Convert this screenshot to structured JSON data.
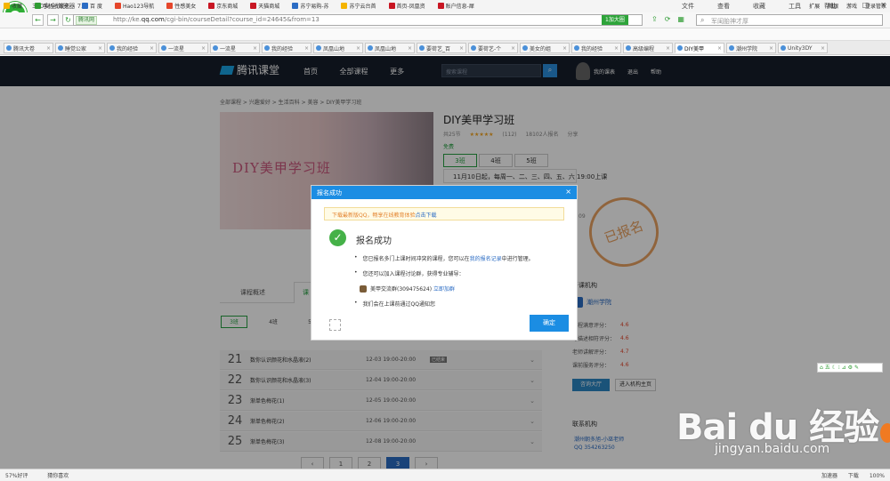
{
  "browser": {
    "app_title": "360安全浏览器 7.1",
    "menu": [
      "文件",
      "查看",
      "收藏",
      "工具",
      "帮助"
    ],
    "url_site": "腾讯网",
    "url_prefix": "http://ke.",
    "url_domain": "qq.com",
    "url_path": "/cgi-bin/courseDetail?course_id=24645&from=13",
    "zoom_label": "1加大圈",
    "search_placeholder": "军闺胎神才厚",
    "favorites": [
      {
        "label": "收藏",
        "color": "#f5b400"
      },
      {
        "label": "手机收藏夹",
        "color": "#2e9b32"
      },
      {
        "label": "百 度",
        "color": "#2b6cc4"
      },
      {
        "label": "Hao123导航",
        "color": "#e5462b"
      },
      {
        "label": "性感美女",
        "color": "#e5462b"
      },
      {
        "label": "京东商城",
        "color": "#c81623"
      },
      {
        "label": "天猫商城",
        "color": "#c81623"
      },
      {
        "label": "苏宁易购-苏",
        "color": "#2b6cc4"
      },
      {
        "label": "苏宁云台首",
        "color": "#f5b400"
      },
      {
        "label": "首页-凤凰资",
        "color": "#c81623"
      },
      {
        "label": "账户信息-犀",
        "color": "#c81623"
      }
    ],
    "fav_right": [
      "扩展",
      "网银",
      "游戏",
      "登录管家"
    ],
    "tabs": [
      {
        "label": "腾讯大卷"
      },
      {
        "label": "睡觉公家"
      },
      {
        "label": "我的经验"
      },
      {
        "label": "一流星"
      },
      {
        "label": "一流星"
      },
      {
        "label": "我的经验"
      },
      {
        "label": "凤凰山地"
      },
      {
        "label": "凤凰山地"
      },
      {
        "label": "要荷艺_百"
      },
      {
        "label": "要荷艺-个"
      },
      {
        "label": "美女的姐"
      },
      {
        "label": "我的经验"
      },
      {
        "label": "高级编程"
      },
      {
        "label": "DIY美甲"
      },
      {
        "label": "潮州学院"
      },
      {
        "label": "Unity3DY"
      }
    ]
  },
  "site": {
    "logo_text": "腾讯课堂",
    "nav": [
      "首页",
      "全部课程",
      "更多"
    ],
    "search_placeholder": "搜索课程",
    "user_links": [
      "我的课表",
      "退出",
      "帮助"
    ]
  },
  "course": {
    "breadcrumb": "全部课程 > 兴趣爱好 > 生活百科 > 美容 > DIY美甲学习班",
    "banner_text": "DIY美甲学习班",
    "title": "DIY美甲学习班",
    "meta_sections": "共25节",
    "stars": "★★★★★",
    "reviews": "(112)",
    "enrolled": "18102人报名",
    "share": "分享",
    "price": "免费",
    "classes": [
      "3班",
      "4班",
      "5班"
    ],
    "class_info": "11月10日起，每周一、二、三、四、五、六 19:00上课",
    "stamp_text": "已报名",
    "stamp_num": "09",
    "tabs": [
      "课程概述",
      "课"
    ],
    "sub_tabs": [
      "3班",
      "4班",
      "5班"
    ],
    "lessons": [
      {
        "num": "21",
        "name": "数你认识颜花和水晶液(2)",
        "time": "12-03 19:00-20:00",
        "badge": "已结束"
      },
      {
        "num": "22",
        "name": "数你认识颜花和水晶液(3)",
        "time": "12-04 19:00-20:00",
        "badge": ""
      },
      {
        "num": "23",
        "name": "渐单色梅花(1)",
        "time": "12-05 19:00-20:00",
        "badge": ""
      },
      {
        "num": "24",
        "name": "渐单色梅花(2)",
        "time": "12-06 19:00-20:00",
        "badge": ""
      },
      {
        "num": "25",
        "name": "渐单色梅花(3)",
        "time": "12-08 19:00-20:00",
        "badge": ""
      }
    ],
    "pager": [
      "‹",
      "1",
      "2",
      "3",
      "›"
    ]
  },
  "side": {
    "title": "开课机构",
    "org": "潮州学院",
    "ratings": [
      {
        "label": "课程满意评分：",
        "value": "4.6"
      },
      {
        "label": "与描述相符评分：",
        "value": "4.6"
      },
      {
        "label": "老师讲解评分：",
        "value": "4.7"
      },
      {
        "label": "课前服务评分：",
        "value": "4.6"
      }
    ],
    "btn_ask": "咨询大厅",
    "btn_org": "进入机构主页",
    "contact_title": "联系机构",
    "contact_line1": "潮州朝多旭-小巫老师",
    "contact_line2": "QQ 354263250"
  },
  "modal": {
    "title": "报名成功",
    "close": "×",
    "notice": "下载最新版QQ，畅享在线教育体验",
    "notice_link": "点击下载",
    "success": "报名成功",
    "line1_a": "您已报名多门上课时间冲突的课程，您可以在",
    "line1_link": "我的报名记录",
    "line1_b": "中进行管理。",
    "line2": "您还可以加入课程讨论群，获得专业辅导：",
    "qq_group": "美甲交流群(309475624)",
    "qq_join": "立即加群",
    "line3": "我们会在上课前通过QQ通知您",
    "confirm": "确定"
  },
  "status": {
    "left": [
      "57%好评",
      "猜你喜欢"
    ],
    "right": [
      "加速器",
      "下载",
      "100%"
    ]
  },
  "watermark": {
    "baidu": "Bai du 经验",
    "url": "jingyan.baidu.com"
  }
}
